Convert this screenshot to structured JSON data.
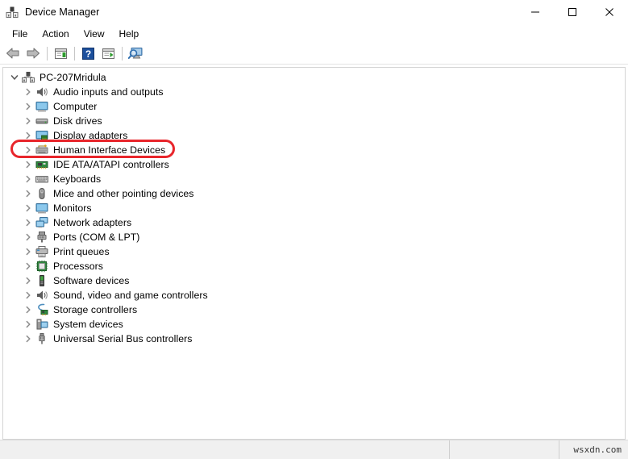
{
  "window": {
    "title": "Device Manager",
    "icon": "device-manager-icon",
    "controls": {
      "minimize": "minimize-icon",
      "maximize": "maximize-icon",
      "close": "close-icon"
    }
  },
  "menubar": {
    "items": [
      {
        "label": "File",
        "name": "menu-file"
      },
      {
        "label": "Action",
        "name": "menu-action"
      },
      {
        "label": "View",
        "name": "menu-view"
      },
      {
        "label": "Help",
        "name": "menu-help"
      }
    ]
  },
  "toolbar": {
    "buttons": [
      {
        "name": "back-arrow-icon",
        "tooltip": "Back"
      },
      {
        "name": "forward-arrow-icon",
        "tooltip": "Forward"
      },
      {
        "name": "show-hide-console-tree-icon",
        "tooltip": "Show/Hide Console Tree"
      },
      {
        "name": "help-icon",
        "tooltip": "Help"
      },
      {
        "name": "properties-icon",
        "tooltip": "Properties"
      },
      {
        "name": "scan-for-hardware-changes-icon",
        "tooltip": "Scan for hardware changes"
      }
    ]
  },
  "tree": {
    "root": {
      "label": "PC-207Mridula",
      "icon": "computer-root-icon",
      "expanded": true
    },
    "items": [
      {
        "label": "Audio inputs and outputs",
        "icon": "speaker-icon",
        "highlighted": false
      },
      {
        "label": "Computer",
        "icon": "monitor-icon",
        "highlighted": false
      },
      {
        "label": "Disk drives",
        "icon": "disk-drive-icon",
        "highlighted": false
      },
      {
        "label": "Display adapters",
        "icon": "display-adapter-icon",
        "highlighted": false
      },
      {
        "label": "Human Interface Devices",
        "icon": "hid-icon",
        "highlighted": true
      },
      {
        "label": "IDE ATA/ATAPI controllers",
        "icon": "ide-controller-icon",
        "highlighted": false
      },
      {
        "label": "Keyboards",
        "icon": "keyboard-icon",
        "highlighted": false
      },
      {
        "label": "Mice and other pointing devices",
        "icon": "mouse-icon",
        "highlighted": false
      },
      {
        "label": "Monitors",
        "icon": "monitor-icon",
        "highlighted": false
      },
      {
        "label": "Network adapters",
        "icon": "network-adapter-icon",
        "highlighted": false
      },
      {
        "label": "Ports (COM & LPT)",
        "icon": "port-icon",
        "highlighted": false
      },
      {
        "label": "Print queues",
        "icon": "printer-icon",
        "highlighted": false
      },
      {
        "label": "Processors",
        "icon": "processor-icon",
        "highlighted": false
      },
      {
        "label": "Software devices",
        "icon": "software-device-icon",
        "highlighted": false
      },
      {
        "label": "Sound, video and game controllers",
        "icon": "sound-controller-icon",
        "highlighted": false
      },
      {
        "label": "Storage controllers",
        "icon": "storage-controller-icon",
        "highlighted": false
      },
      {
        "label": "System devices",
        "icon": "system-device-icon",
        "highlighted": false
      },
      {
        "label": "Universal Serial Bus controllers",
        "icon": "usb-controller-icon",
        "highlighted": false
      }
    ],
    "collapsed_glyph": "›",
    "expanded_glyph": "⌄"
  },
  "annotation": {
    "target": "Human Interface Devices",
    "color": "#e8252b",
    "shape": "rounded-rectangle"
  },
  "statusbar": {
    "pane1": "",
    "pane2": "",
    "pane3": "wsxdn.com"
  }
}
